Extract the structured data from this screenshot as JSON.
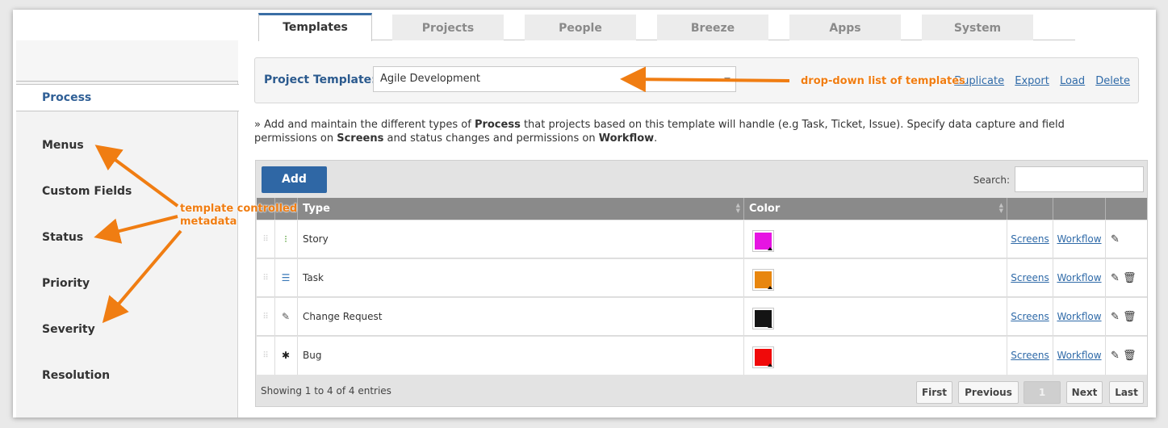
{
  "tabs": [
    {
      "label": "Templates",
      "active": true
    },
    {
      "label": "Projects"
    },
    {
      "label": "People"
    },
    {
      "label": "Breeze"
    },
    {
      "label": "Apps"
    },
    {
      "label": "System"
    }
  ],
  "sidebar": {
    "active": "Process",
    "items": [
      "Menus",
      "Custom Fields",
      "Status",
      "Priority",
      "Severity",
      "Resolution"
    ]
  },
  "template_bar": {
    "label": "Project Template:",
    "selected": "Agile Development",
    "links": [
      "Duplicate",
      "Export",
      "Load",
      "Delete"
    ]
  },
  "annotations": {
    "dropdown": "drop-down list of templates",
    "metadata_line1": "template controlled",
    "metadata_line2": "metadata",
    "color": "#f07d12"
  },
  "description": {
    "prefix": "» Add and maintain the different types of ",
    "b1": "Process",
    "mid1": " that projects based on this template will handle (e.g Task, Ticket, Issue). Specify data capture and field permissions on ",
    "b2": "Screens",
    "mid2": " and status changes and permissions on ",
    "b3": "Workflow",
    "suffix": "."
  },
  "grid": {
    "add_label": "Add",
    "search_label": "Search:",
    "search_value": "",
    "columns": {
      "type": "Type",
      "color": "Color"
    },
    "rows": [
      {
        "type": "Story",
        "color": "#e614e2",
        "icon": "story-icon",
        "screens": "Screens",
        "workflow": "Workflow",
        "deletable": false
      },
      {
        "type": "Task",
        "color": "#e8860e",
        "icon": "task-list-icon",
        "screens": "Screens",
        "workflow": "Workflow",
        "deletable": true
      },
      {
        "type": "Change Request",
        "color": "#141414",
        "icon": "change-request-icon",
        "screens": "Screens",
        "workflow": "Workflow",
        "deletable": true
      },
      {
        "type": "Bug",
        "color": "#f00a0a",
        "icon": "bug-icon",
        "screens": "Screens",
        "workflow": "Workflow",
        "deletable": true
      }
    ],
    "footer": "Showing 1 to 4 of 4 entries",
    "pagination": {
      "first": "First",
      "previous": "Previous",
      "current": "1",
      "next": "Next",
      "last": "Last"
    }
  }
}
